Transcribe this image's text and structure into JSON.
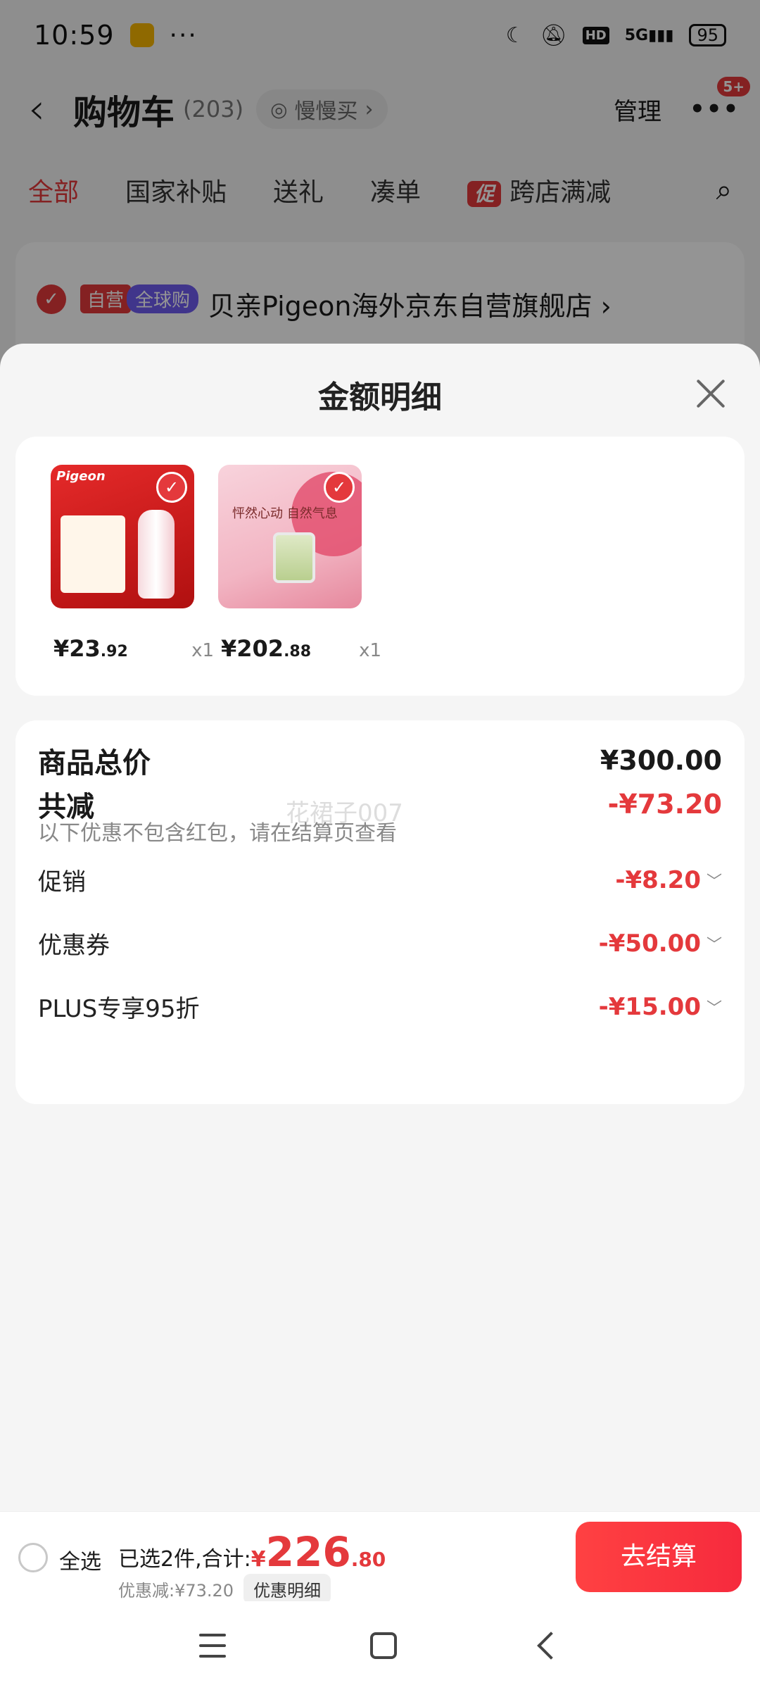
{
  "status_bar": {
    "time": "10:59",
    "dots": "···",
    "network": "5G",
    "hd": "HD",
    "battery": "95"
  },
  "header": {
    "title": "购物车",
    "count": "(203)",
    "slow_buy": "慢慢买",
    "manage": "管理",
    "badge": "5+"
  },
  "filter_tabs": [
    {
      "label": "全部"
    },
    {
      "label": "国家补贴"
    },
    {
      "label": "送礼"
    },
    {
      "label": "凑单"
    },
    {
      "label": "跨店满减",
      "tag": "促"
    }
  ],
  "store": {
    "self_tag": "自营",
    "global_tag": "全球购",
    "name": "贝亲Pigeon海外京东自营旗舰店",
    "chevron": "›"
  },
  "sheet": {
    "title": "金额明细",
    "items": [
      {
        "brand": "Pigeon",
        "price_int": "¥23",
        "price_dec": ".92",
        "qty": "x1"
      },
      {
        "brand": "",
        "thumb_text": "怦然心动 自然气息",
        "price_int": "¥202",
        "price_dec": ".88",
        "qty": "x1"
      }
    ],
    "summary": {
      "total_label": "商品总价",
      "total_value": "¥300.00",
      "reduce_label": "共减",
      "reduce_value": "-¥73.20",
      "note": "以下优惠不包含红包，请在结算页查看",
      "watermark": "花裙子007",
      "lines": [
        {
          "label": "促销",
          "value": "-¥8.20"
        },
        {
          "label": "优惠券",
          "value": "-¥50.00"
        },
        {
          "label": "PLUS专享95折",
          "value": "-¥15.00"
        }
      ]
    }
  },
  "checkout": {
    "select_all": "全选",
    "selected_text": "已选2件,合计:",
    "total_symbol": "¥",
    "total_int": "226",
    "total_dec": ".80",
    "discount_text": "优惠减:¥73.20",
    "detail_button": "优惠明细",
    "checkout_button": "去结算"
  },
  "colors": {
    "accent": "#e4393c",
    "background": "#f5f5f5"
  }
}
